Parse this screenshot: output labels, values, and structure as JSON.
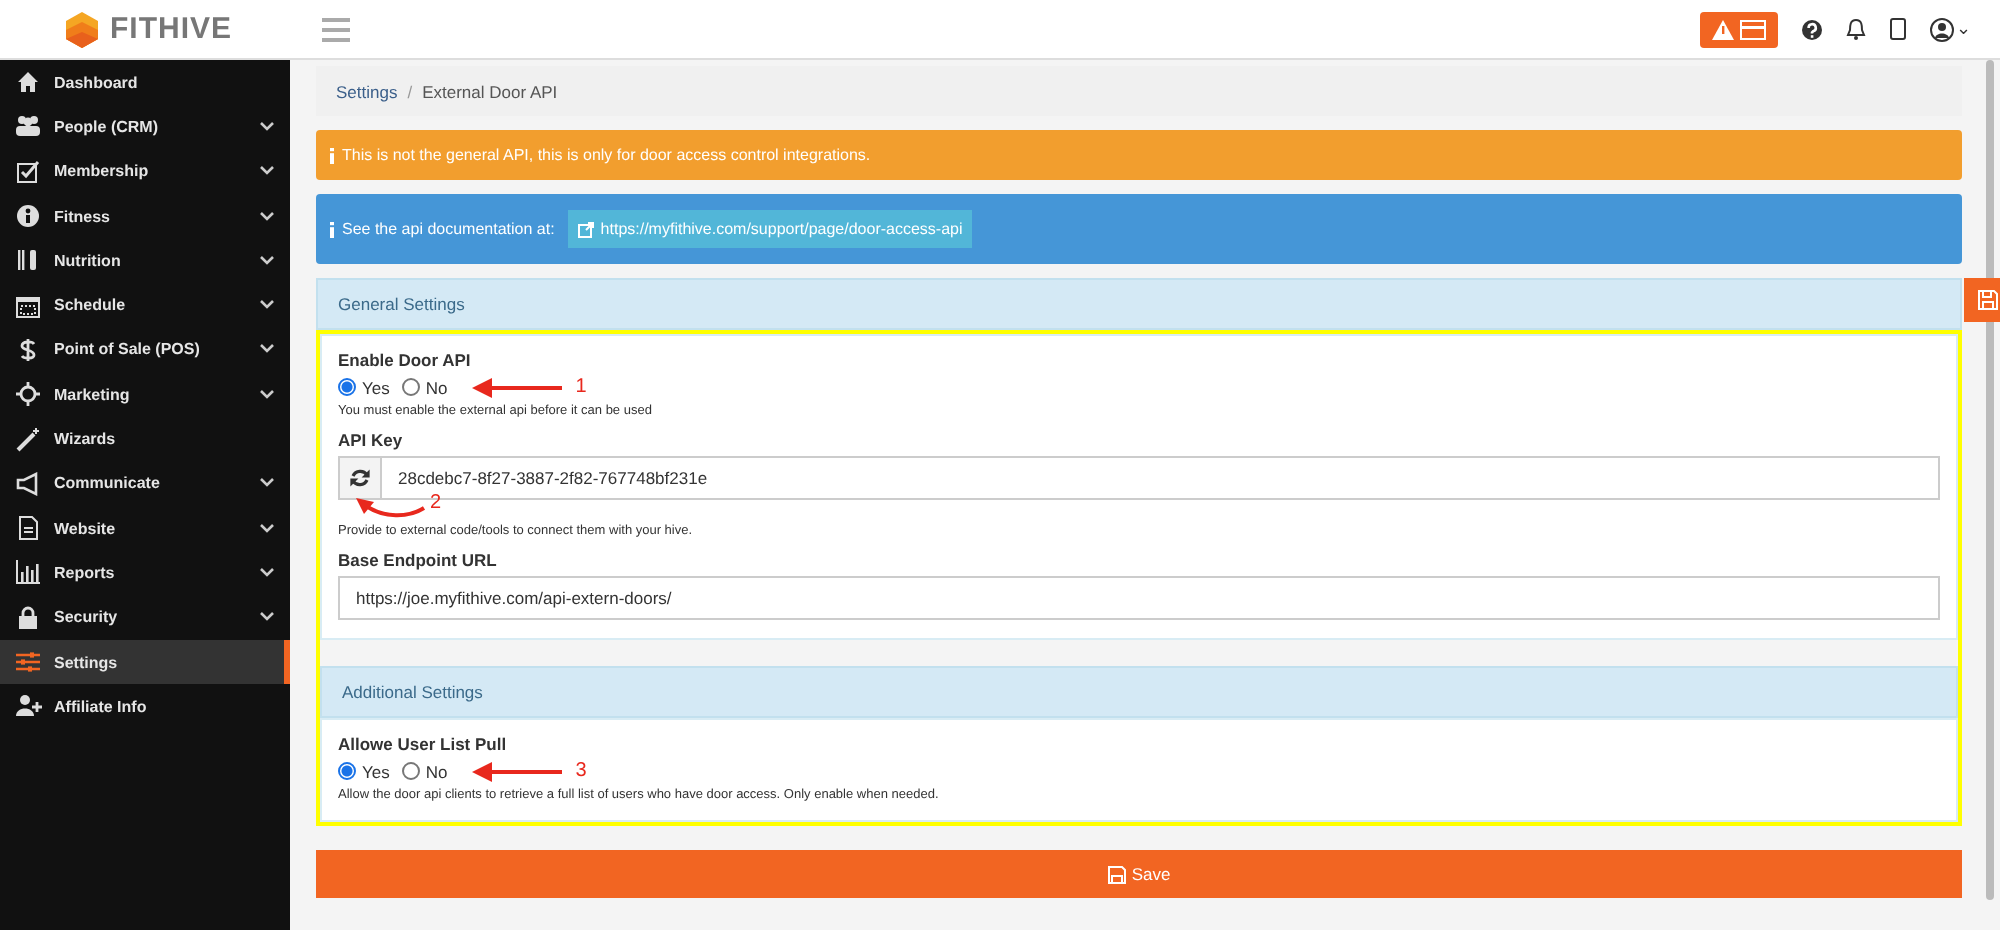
{
  "header": {
    "logo": "FITHIVE",
    "user_caret": "⌄"
  },
  "sidebar": {
    "items": [
      {
        "label": "Dashboard",
        "has_submenu": false,
        "selected": false
      },
      {
        "label": "People (CRM)",
        "has_submenu": true,
        "selected": false
      },
      {
        "label": "Membership",
        "has_submenu": true,
        "selected": false
      },
      {
        "label": "Fitness",
        "has_submenu": true,
        "selected": false
      },
      {
        "label": "Nutrition",
        "has_submenu": true,
        "selected": false
      },
      {
        "label": "Schedule",
        "has_submenu": true,
        "selected": false
      },
      {
        "label": "Point of Sale (POS)",
        "has_submenu": true,
        "selected": false
      },
      {
        "label": "Marketing",
        "has_submenu": true,
        "selected": false
      },
      {
        "label": "Wizards",
        "has_submenu": false,
        "selected": false
      },
      {
        "label": "Communicate",
        "has_submenu": true,
        "selected": false
      },
      {
        "label": "Website",
        "has_submenu": true,
        "selected": false
      },
      {
        "label": "Reports",
        "has_submenu": true,
        "selected": false
      },
      {
        "label": "Security",
        "has_submenu": true,
        "selected": false
      },
      {
        "label": "Settings",
        "has_submenu": false,
        "selected": true
      },
      {
        "label": "Affiliate Info",
        "has_submenu": false,
        "selected": false
      }
    ]
  },
  "breadcrumb": [
    {
      "label": "Settings",
      "link": true
    },
    {
      "label": "External Door API",
      "link": false
    }
  ],
  "breadcrumb_separator": "/",
  "alerts": [
    {
      "kind": "warning",
      "text": "This is not the general API, this is only for door access control integrations."
    },
    {
      "kind": "info",
      "text": "See the api documentation at:",
      "link": "https://myfithive.com/support/page/door-access-api"
    }
  ],
  "general_settings": {
    "title": "General Settings",
    "fields": [
      {
        "kind": "radio",
        "label": "Enable Door API",
        "options": [
          {
            "label": "Yes",
            "selected": true
          },
          {
            "label": "No",
            "selected": false
          }
        ],
        "help": "You must enable the external api before it can be used",
        "annotation": "1"
      },
      {
        "kind": "key",
        "label": "API Key",
        "value": "28cdebc7-8f27-3887-2f82-767748bf231e",
        "help": "Provide to external code/tools to connect them with your hive.",
        "annotation": "2"
      },
      {
        "kind": "text",
        "label": "Base Endpoint URL",
        "value": "https://joe.myfithive.com/api-extern-doors/"
      }
    ]
  },
  "additional_settings": {
    "title": "Additional Settings",
    "fields": [
      {
        "kind": "radio",
        "label": "Allowe User List Pull",
        "options": [
          {
            "label": "Yes",
            "selected": true
          },
          {
            "label": "No",
            "selected": false
          }
        ],
        "help": "Allow the door api clients to retrieve a full list of users who have door access. Only enable when needed.",
        "annotation": "3"
      }
    ]
  },
  "save_button": "Save"
}
